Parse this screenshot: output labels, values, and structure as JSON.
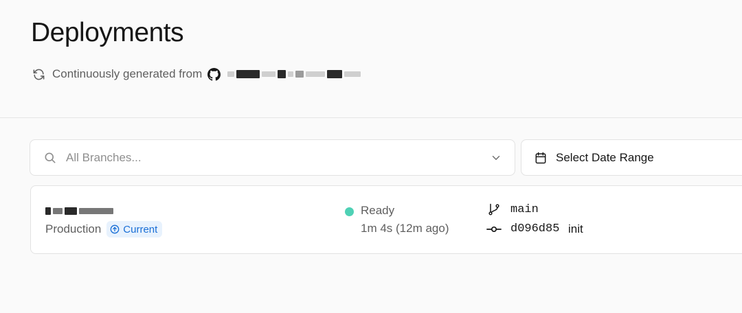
{
  "header": {
    "title": "Deployments",
    "source_prefix": "Continuously generated from",
    "icons": {
      "refresh": "refresh-icon",
      "github": "github-icon"
    }
  },
  "filters": {
    "branch_placeholder": "All Branches...",
    "date_range_label": "Select Date Range",
    "icons": {
      "search": "search-icon",
      "chevron": "chevron-down-icon",
      "calendar": "calendar-icon"
    }
  },
  "deployment": {
    "environment": "Production",
    "badge": "Current",
    "status": "Ready",
    "status_color": "#4fd1b5",
    "duration": "1m 4s (12m ago)",
    "branch": "main",
    "commit_hash": "d096d85",
    "commit_message": "init"
  },
  "colors": {
    "badge_bg": "#e8f2fd",
    "badge_text": "#1a6fd6"
  }
}
